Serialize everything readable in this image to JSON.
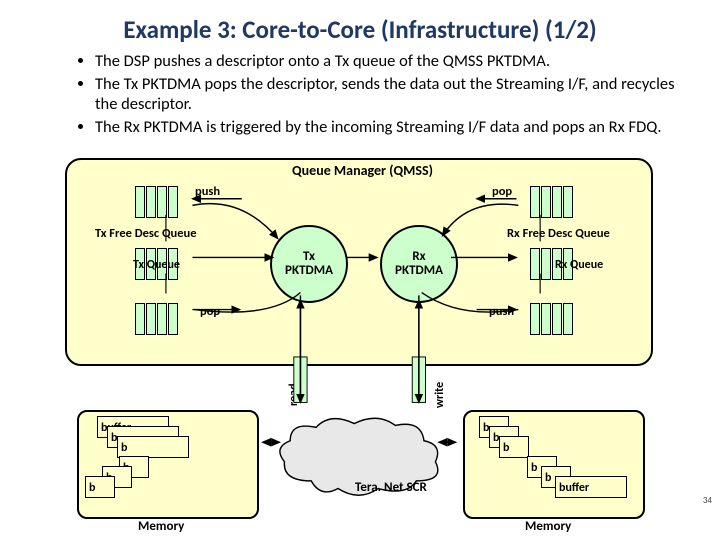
{
  "title": "Example 3: Core-to-Core (Infrastructure) (1/2)",
  "bullets": [
    "The DSP pushes a descriptor onto a Tx queue of the QMSS PKTDMA.",
    "The Tx PKTDMA pops the descriptor, sends the data out the Streaming I/F, and recycles the descriptor.",
    "The Rx PKTDMA is triggered by the incoming Streaming I/F data and pops an Rx FDQ."
  ],
  "qmss": {
    "title": "Queue Manager (QMSS)",
    "push_left": "push",
    "pop_right": "pop",
    "pop_left": "pop",
    "push_right": "push",
    "tx_free": "Tx Free Desc Queue",
    "tx_queue": "Tx Queue",
    "rx_free": "Rx Free Desc Queue",
    "rx_queue": "Rx Queue",
    "tx_pktdma": "Tx\nPKTDMA",
    "rx_pktdma": "Rx\nPKTDMA"
  },
  "io": {
    "read": "read",
    "write": "write"
  },
  "buffers": {
    "label": "buffer",
    "short": "b"
  },
  "memory": "Memory",
  "teranet": "Tera. Net SCR",
  "pagenum": "34"
}
